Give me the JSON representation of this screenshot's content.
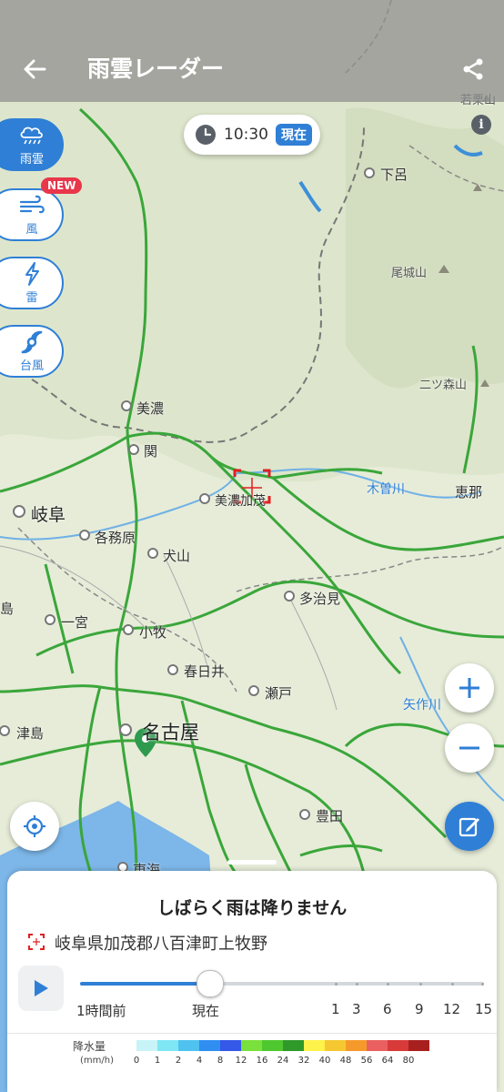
{
  "header": {
    "title": "雨雲レーダー"
  },
  "time": {
    "value": "10:30",
    "now_badge": "現在"
  },
  "side_menu": [
    {
      "label": "雨雲",
      "icon": "rain-cloud-icon",
      "active": true
    },
    {
      "label": "風",
      "icon": "wind-icon",
      "active": false,
      "badge": "NEW"
    },
    {
      "label": "雷",
      "icon": "lightning-icon",
      "active": false
    },
    {
      "label": "台風",
      "icon": "typhoon-icon",
      "active": false
    }
  ],
  "map_labels": {
    "gero": "下呂",
    "wakakuri": "若栗山",
    "bikosan": "尾城山",
    "futatsumori": "二ツ森山",
    "mino": "美濃",
    "seki": "関",
    "gifu": "岐阜",
    "minokamo": "美濃加茂",
    "kisogawa": "木曽川",
    "ena": "恵那",
    "kakamigahara": "各務原",
    "inuyama": "犬山",
    "tajimi": "多治見",
    "ichinomiya": "一宮",
    "komaki": "小牧",
    "kasugai": "春日井",
    "seto": "瀬戸",
    "yahagigawa": "矢作川",
    "tsushima": "津島",
    "nagoya": "名古屋",
    "toyota": "豊田",
    "tokai": "東海",
    "island": "島"
  },
  "sheet": {
    "headline": "しばらく雨は降りません",
    "address": "岐阜県加茂郡八百津町上牧野",
    "timeline": {
      "labels": [
        "1時間前",
        "現在",
        "1",
        "3",
        "6",
        "9",
        "12",
        "15"
      ],
      "position_fraction": 0.32
    },
    "legend": {
      "title": "降水量",
      "unit": "(mm/h)",
      "values": [
        "0",
        "1",
        "2",
        "4",
        "8",
        "12",
        "16",
        "24",
        "32",
        "40",
        "48",
        "56",
        "64",
        "80"
      ],
      "colors": [
        "#c8f4f8",
        "#7fe6f4",
        "#4fc2f0",
        "#2f8ef0",
        "#3458e8",
        "#7ae03c",
        "#4fc830",
        "#2f9a2a",
        "#fff24a",
        "#f5c832",
        "#f59a2a",
        "#ea6060",
        "#d83a3a",
        "#a8201e"
      ]
    }
  },
  "colors": {
    "accent": "#2f7fd6",
    "road": "#3aa63a",
    "water": "#3c8fd8"
  }
}
